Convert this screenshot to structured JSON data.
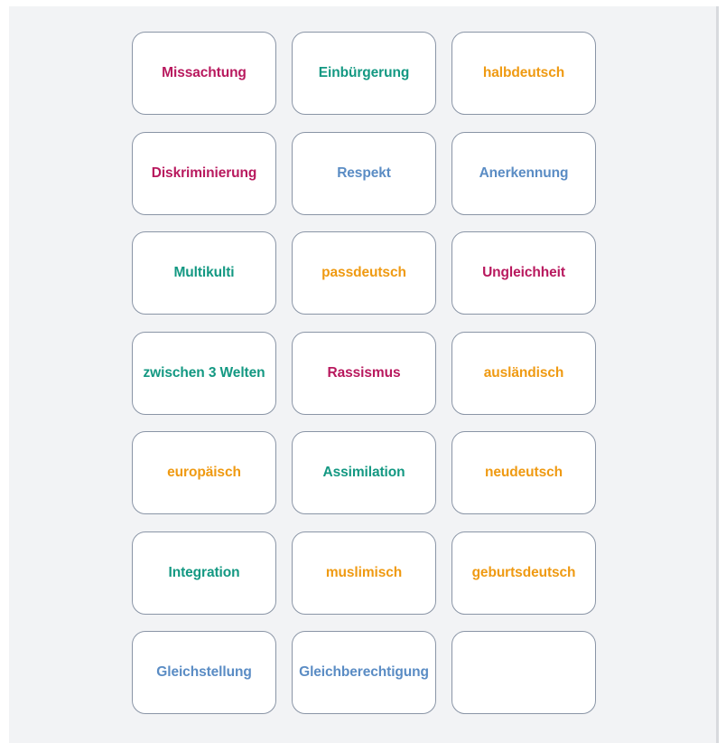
{
  "colors": {
    "red": "#b8195e",
    "teal": "#139882",
    "orange": "#ef9a12",
    "blue": "#5a8cc4",
    "card_border": "#8a95a6",
    "page_background": "#f2f3f5"
  },
  "cards": [
    {
      "word": "Missachtung",
      "color": "red"
    },
    {
      "word": "Einbürgerung",
      "color": "teal"
    },
    {
      "word": "halbdeutsch",
      "color": "orange"
    },
    {
      "word": "Diskriminierung",
      "color": "red"
    },
    {
      "word": "Respekt",
      "color": "blue"
    },
    {
      "word": "Anerkennung",
      "color": "blue"
    },
    {
      "word": "Multikulti",
      "color": "teal"
    },
    {
      "word": "passdeutsch",
      "color": "orange"
    },
    {
      "word": "Ungleichheit",
      "color": "red"
    },
    {
      "word": "zwischen 3 Welten",
      "color": "teal"
    },
    {
      "word": "Rassismus",
      "color": "red"
    },
    {
      "word": "ausländisch",
      "color": "orange"
    },
    {
      "word": "europäisch",
      "color": "orange"
    },
    {
      "word": "Assimilation",
      "color": "teal"
    },
    {
      "word": "neudeutsch",
      "color": "orange"
    },
    {
      "word": "Integration",
      "color": "teal"
    },
    {
      "word": "muslimisch",
      "color": "orange"
    },
    {
      "word": "geburtsdeutsch",
      "color": "orange"
    },
    {
      "word": "Gleichstellung",
      "color": "blue"
    },
    {
      "word": "Gleichberechtigung",
      "color": "blue"
    },
    {
      "word": "",
      "color": "blue"
    }
  ]
}
